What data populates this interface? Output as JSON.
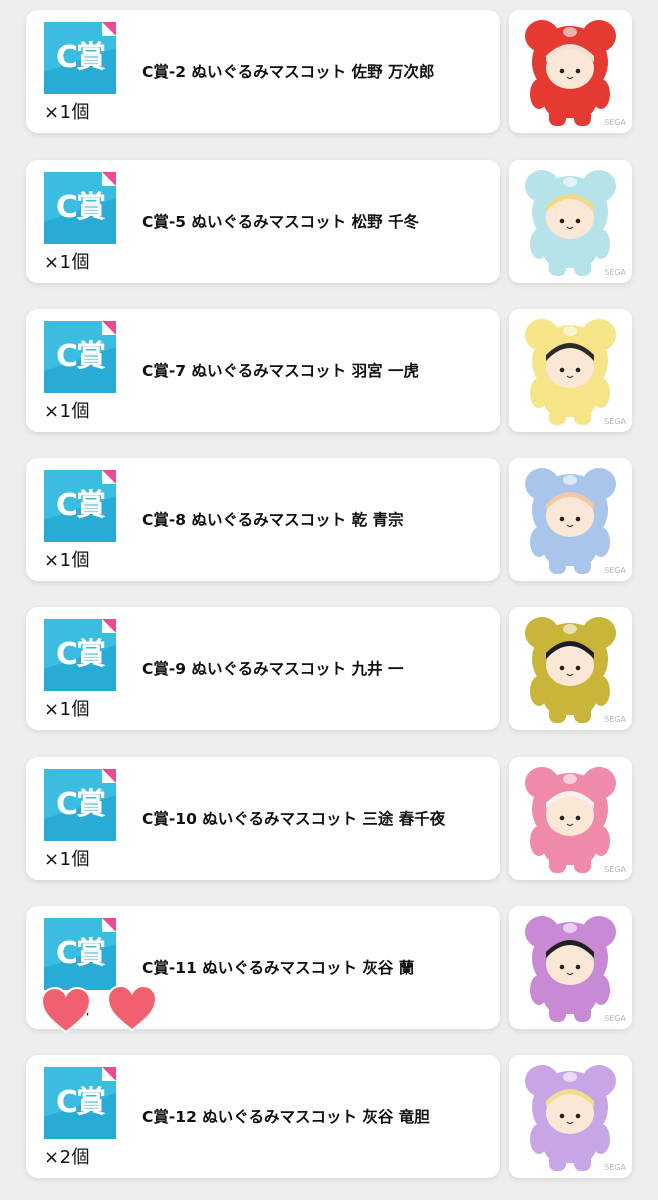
{
  "colors": {
    "page_bg": "#eeeeee",
    "card_bg": "#ffffff",
    "badge_blue": "#1fa9d6",
    "badge_pink": "#e94d8f",
    "heart": "#f0606e"
  },
  "items": [
    {
      "badge": "C賞",
      "name": "C賞-2 ぬいぐるみマスコット 佐野 万次郎",
      "qty": "×1個",
      "plush_color": "#e53a32",
      "hair_color": "#f1e3d3",
      "watermark": "SEGA"
    },
    {
      "badge": "C賞",
      "name": "C賞-5 ぬいぐるみマスコット 松野 千冬",
      "qty": "×1個",
      "plush_color": "#b6e2ea",
      "hair_color": "#f2d98a",
      "watermark": "SEGA"
    },
    {
      "badge": "C賞",
      "name": "C賞-7 ぬいぐるみマスコット 羽宮 一虎",
      "qty": "×1個",
      "plush_color": "#f6e489",
      "hair_color": "#2d2a24",
      "watermark": "SEGA"
    },
    {
      "badge": "C賞",
      "name": "C賞-8 ぬいぐるみマスコット 乾 青宗",
      "qty": "×1個",
      "plush_color": "#a9c5ec",
      "hair_color": "#f2c9a6",
      "watermark": "SEGA"
    },
    {
      "badge": "C賞",
      "name": "C賞-9 ぬいぐるみマスコット 九井 一",
      "qty": "×1個",
      "plush_color": "#c8b53a",
      "hair_color": "#1e1c1e",
      "watermark": "SEGA"
    },
    {
      "badge": "C賞",
      "name": "C賞-10 ぬいぐるみマスコット 三途 春千夜",
      "qty": "×1個",
      "plush_color": "#ef8aa8",
      "hair_color": "#f4f1ef",
      "watermark": "SEGA"
    },
    {
      "badge": "C賞",
      "name": "C賞-11 ぬいぐるみマスコット 灰谷 蘭",
      "qty": "×1個",
      "plush_color": "#c88ad5",
      "hair_color": "#222222",
      "watermark": "SEGA"
    },
    {
      "badge": "C賞",
      "name": "C賞-12 ぬいぐるみマスコット 灰谷 竜胆",
      "qty": "×2個",
      "plush_color": "#c8a6e6",
      "hair_color": "#f3dc8a",
      "watermark": "SEGA"
    }
  ],
  "overlay": {
    "heart_sticker_count": 2
  }
}
